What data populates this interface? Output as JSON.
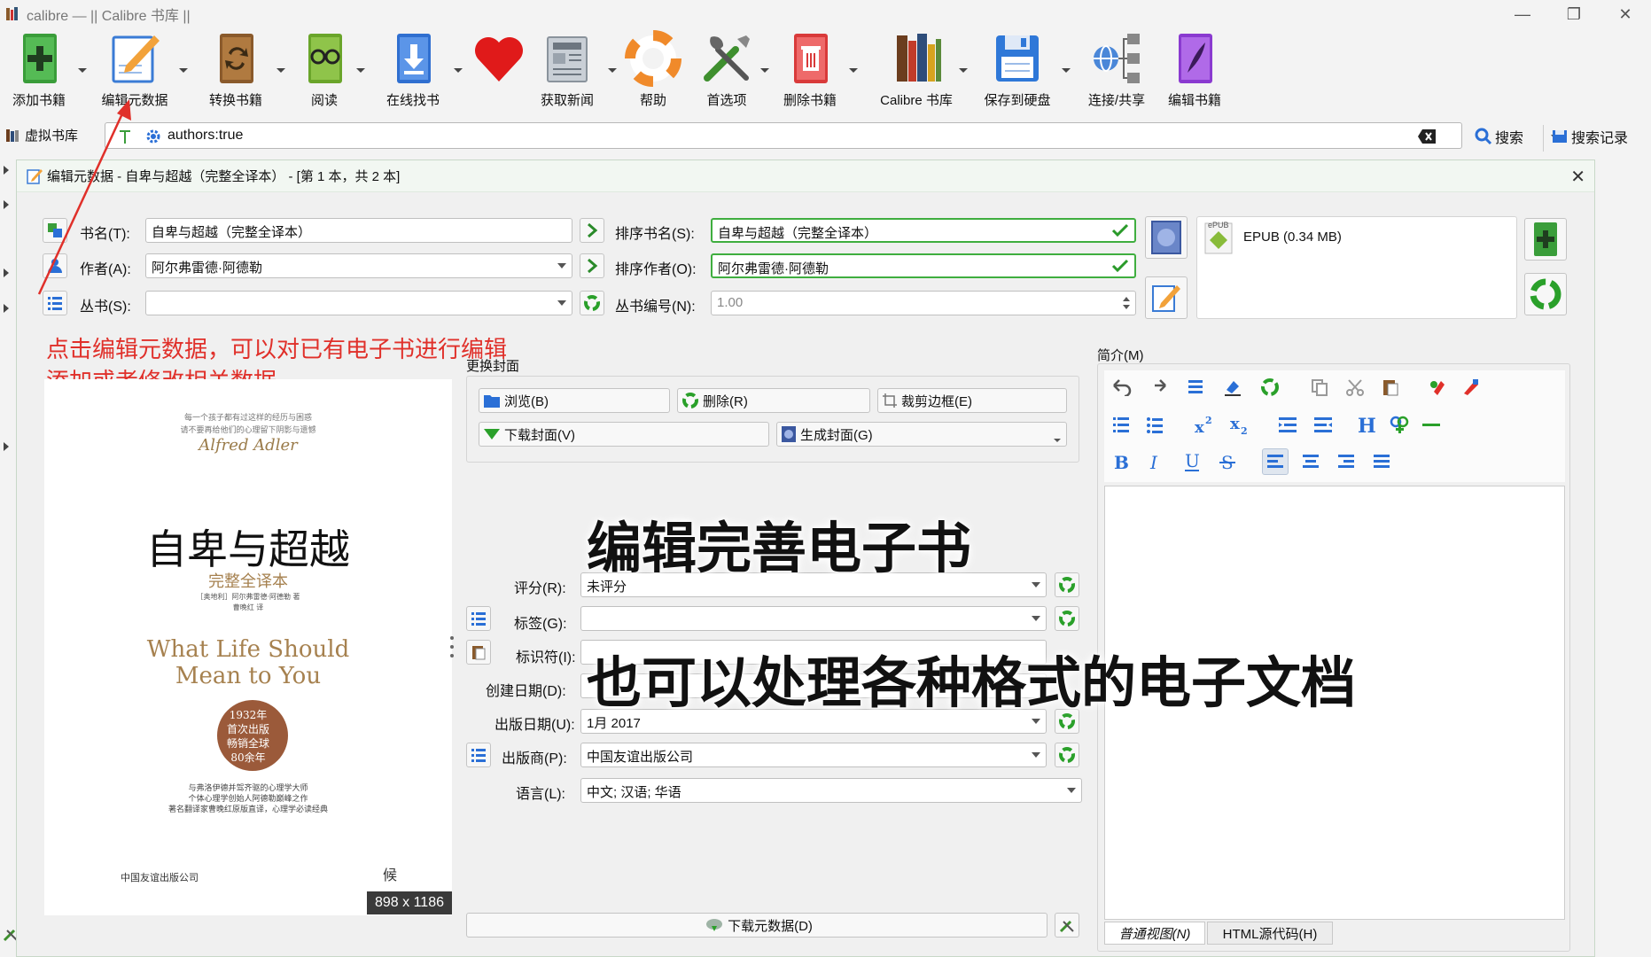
{
  "window": {
    "title": "calibre — || Calibre 书库 ||",
    "minimize": "—",
    "maximize": "❐",
    "close": "✕"
  },
  "toolbar": {
    "add_books": "添加书籍",
    "edit_metadata": "编辑元数据",
    "convert_books": "转换书籍",
    "view": "阅读",
    "get_books": "在线找书",
    "fetch_news": "获取新闻",
    "help": "帮助",
    "preferences": "首选项",
    "remove_books": "删除书籍",
    "calibre_library": "Calibre 书库",
    "save_to_disk": "保存到硬盘",
    "connect_share": "连接/共享",
    "edit_book": "编辑书籍"
  },
  "searchbar": {
    "virtual_library": "虚拟书库",
    "query": "authors:true",
    "search_button": "搜索",
    "saved_searches": "搜索记录"
  },
  "dialog": {
    "title": "编辑元数据 - 自卑与超越（完整全译本） - [第 1 本，共 2 本]",
    "close": "✕",
    "fields": {
      "title_label": "书名(T):",
      "title_value": "自卑与超越（完整全译本）",
      "title_sort_label": "排序书名(S):",
      "title_sort_value": "自卑与超越（完整全译本）",
      "author_label": "作者(A):",
      "author_value": "阿尔弗雷德·阿德勒",
      "author_sort_label": "排序作者(O):",
      "author_sort_value": "阿尔弗雷德·阿德勒",
      "series_label": "丛书(S):",
      "series_value": "",
      "series_index_label": "丛书编号(N):",
      "series_index_value": "1.00",
      "rating_label": "评分(R):",
      "rating_value": "未评分",
      "tags_label": "标签(G):",
      "tags_value": "",
      "ids_label": "标识符(I):",
      "ids_value": "",
      "date_label": "创建日期(D):",
      "date_value": "",
      "pubdate_label": "出版日期(U):",
      "pubdate_value": "1月 2017",
      "publisher_label": "出版商(P):",
      "publisher_value": "中国友谊出版公司",
      "languages_label": "语言(L):",
      "languages_value": "中文; 汉语; 华语"
    },
    "format": {
      "name": "EPUB (0.34 MB)",
      "badge": "ePUB"
    },
    "cover_group": {
      "title": "更换封面",
      "browse": "浏览(B)",
      "remove": "删除(R)",
      "trim": "裁剪边框(E)",
      "download": "下载封面(V)",
      "generate": "生成封面(G)"
    },
    "comments_label": "简介(M)",
    "editor_tabs": {
      "normal": "普通视图(N)",
      "html": "HTML源代码(H)"
    },
    "download_metadata": "下载元数据(D)",
    "cover_dims": "898 x 1186"
  },
  "cover": {
    "top_line1": "每一个孩子都有过这样的经历与困惑",
    "top_line2": "请不要再给他们的心理留下阴影与遗憾",
    "signature": "Alfred Adler",
    "title_cn": "自卑与超越",
    "subtitle": "完整全译本",
    "author_line": "［奥地利］阿尔弗雷德·阿德勒 著",
    "translator": "曹晚红 译",
    "title_en_1": "What Life Should",
    "title_en_2": "Mean to You",
    "seal_1": "1932年",
    "seal_2": "首次出版",
    "seal_3": "畅销全球",
    "seal_4": "80余年",
    "blurb_1": "与弗洛伊德并驾齐驱的心理学大师",
    "blurb_2": "个体心理学创始人阿德勒巅峰之作",
    "blurb_3": "著名翻译家曹晚红原版直译，心理学必读经典",
    "publisher_logo": "中国友谊出版公司",
    "imprint": "候"
  },
  "annotations": {
    "line1": "点击编辑元数据，可以对已有电子书进行编辑",
    "line2": "添加或者修改相关数据",
    "overlay1": "编辑完善电子书",
    "overlay2": "也可以处理各种格式的电子文档"
  },
  "colors": {
    "green_ok": "#3fae3f",
    "accent_blue": "#2a6fd6",
    "annotation_red": "#e0302a"
  }
}
